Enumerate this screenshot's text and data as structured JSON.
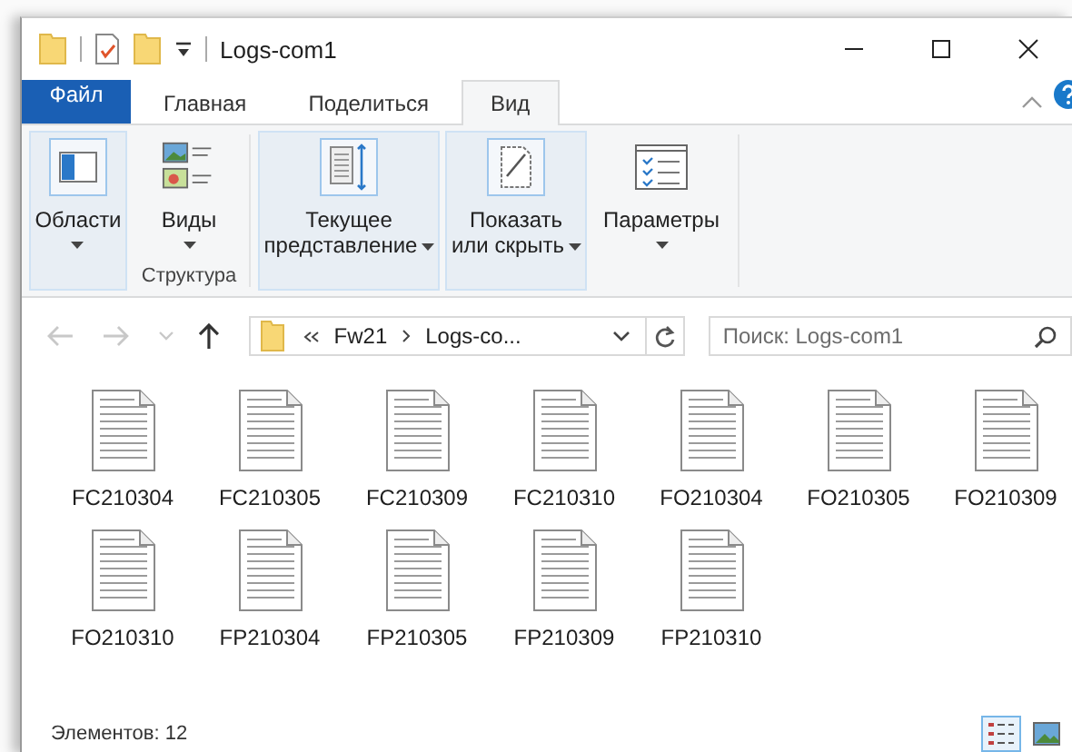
{
  "window": {
    "title": "Logs-com1"
  },
  "tabs": [
    {
      "label": "Файл",
      "kind": "file",
      "selected": false
    },
    {
      "label": "Главная",
      "kind": "tab",
      "selected": false
    },
    {
      "label": "Поделиться",
      "kind": "tab",
      "selected": false
    },
    {
      "label": "Вид",
      "kind": "tab",
      "selected": true
    }
  ],
  "ribbon": {
    "groups": [
      {
        "label": "Структура",
        "buttons": [
          {
            "label": "Области",
            "kind": "panes",
            "highlighted": true,
            "dropdown": true
          },
          {
            "label": "Виды",
            "kind": "views",
            "highlighted": false,
            "dropdown": true
          }
        ]
      },
      {
        "buttons": [
          {
            "label": "Текущее представление",
            "kind": "current-view",
            "highlighted": true,
            "dropdown": true
          },
          {
            "label": "Показать или скрыть",
            "kind": "show-hide",
            "highlighted": true,
            "dropdown": true
          },
          {
            "label": "Параметры",
            "kind": "options",
            "highlighted": false,
            "dropdown": true
          }
        ]
      }
    ]
  },
  "nav": {
    "buttons": [
      {
        "kind": "back",
        "disabled": true
      },
      {
        "kind": "forward",
        "disabled": true
      },
      {
        "kind": "recent",
        "disabled": true
      },
      {
        "kind": "up",
        "disabled": false
      }
    ],
    "path": [
      "Fw21",
      "Logs-co..."
    ],
    "search": {
      "placeholder": "Поиск: Logs-com1"
    }
  },
  "files": [
    "FC210304",
    "FC210305",
    "FC210309",
    "FC210310",
    "FO210304",
    "FO210305",
    "FO210309",
    "FO210310",
    "FP210304",
    "FP210305",
    "FP210309",
    "FP210310"
  ],
  "status_bar": {
    "text": "Элементов: 12",
    "views": [
      {
        "kind": "details",
        "selected": true
      },
      {
        "kind": "large-icons",
        "selected": false
      }
    ]
  }
}
